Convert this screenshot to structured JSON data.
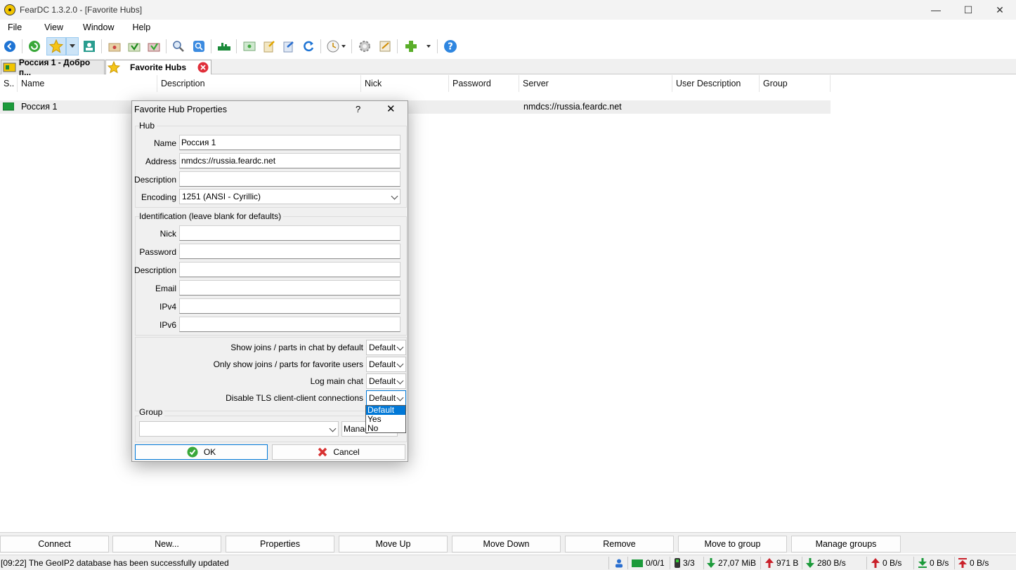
{
  "window": {
    "title": "FearDC 1.3.2.0 - [Favorite Hubs]",
    "minimize": "—",
    "maximize": "☐",
    "close": "✕"
  },
  "menu": {
    "items": [
      "File",
      "View",
      "Window",
      "Help"
    ]
  },
  "toolbar": {
    "icons": [
      "back-icon",
      "refresh-icon",
      "favorites-star-icon",
      "dropdown-arrow-icon",
      "users-icon",
      "open-folder-icon",
      "download-queue-icon",
      "finished-downloads-icon",
      "search-icon",
      "search-spy-icon",
      "network-stats-icon",
      "own-file-list-icon",
      "open-file-list-icon",
      "share-icon",
      "refresh-share-icon",
      "clock-icon",
      "settings-gear-icon",
      "notepad-icon",
      "plugins-icon",
      "help-icon"
    ],
    "colors": {
      "active_bg": "#cce4f7",
      "accent_blue": "#1e74d4"
    }
  },
  "tabs": [
    {
      "label": "Россия 1 - Добро п...",
      "selected": false
    },
    {
      "label": "Favorite Hubs",
      "selected": true
    }
  ],
  "list": {
    "columns": [
      "S..",
      "Name",
      "Description",
      "Nick",
      "Password",
      "Server",
      "User Description",
      "Group"
    ],
    "rows": [
      {
        "name": "Россия 1",
        "server": "nmdcs://russia.feardc.net"
      }
    ]
  },
  "dialog": {
    "title": "Favorite Hub Properties",
    "help": "?",
    "close": "✕",
    "hub": {
      "legend": "Hub",
      "name_label": "Name",
      "name_value": "Россия 1",
      "address_label": "Address",
      "address_value": "nmdcs://russia.feardc.net",
      "description_label": "Description",
      "description_value": "",
      "encoding_label": "Encoding",
      "encoding_value": "1251  (ANSI - Cyrillic)"
    },
    "identification": {
      "legend": "Identification (leave blank for defaults)",
      "nick_label": "Nick",
      "password_label": "Password",
      "description_label": "Description",
      "email_label": "Email",
      "ipv4_label": "IPv4",
      "ipv6_label": "IPv6"
    },
    "options": [
      {
        "label": "Show joins / parts in chat by default",
        "value": "Default"
      },
      {
        "label": "Only show joins / parts for favorite users",
        "value": "Default"
      },
      {
        "label": "Log main chat",
        "value": "Default"
      },
      {
        "label": "Disable TLS client-client connections",
        "value": "Default"
      }
    ],
    "dropdown_options": [
      "Default",
      "Yes",
      "No"
    ],
    "group": {
      "legend": "Group",
      "value": "",
      "manage_label": "Manage"
    },
    "ok_label": "OK",
    "cancel_label": "Cancel"
  },
  "bottom_buttons": [
    "Connect",
    "New...",
    "Properties",
    "Move Up",
    "Move Down",
    "Remove",
    "Move to group",
    "Manage groups"
  ],
  "status": {
    "message": "[09:22] The GeoIP2 database has been successfully updated",
    "hubs": "0/0/1",
    "slots": "3/3",
    "downloaded": "27,07 MiB",
    "uploaded": "971 B",
    "down_speed": "280 B/s",
    "up_speed": "0 B/s",
    "down_limit": "0 B/s",
    "up_limit": "0 B/s"
  }
}
